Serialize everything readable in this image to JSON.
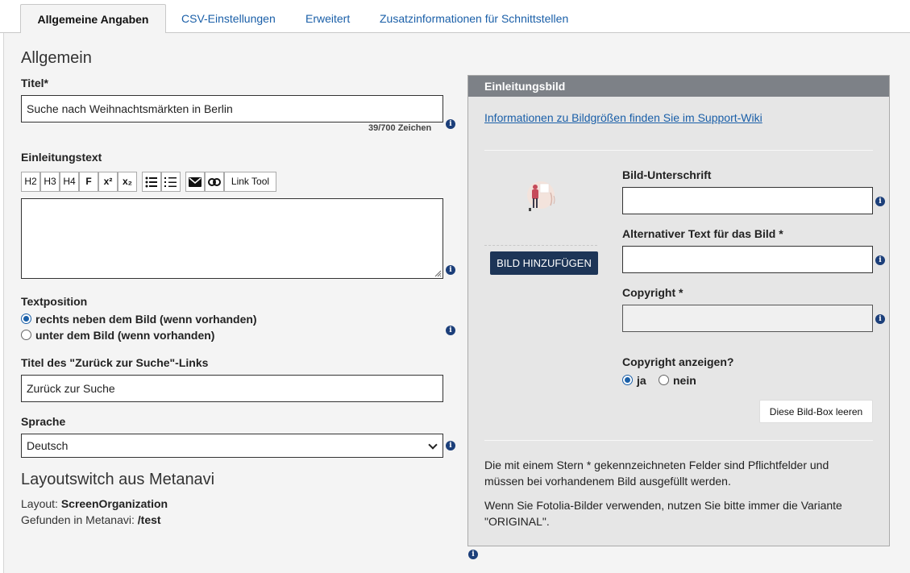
{
  "tabs": [
    {
      "label": "Allgemeine Angaben",
      "active": true
    },
    {
      "label": "CSV-Einstellungen",
      "active": false
    },
    {
      "label": "Erweitert",
      "active": false
    },
    {
      "label": "Zusatzinformationen für Schnittstellen",
      "active": false
    }
  ],
  "general": {
    "heading": "Allgemein",
    "title_label": "Titel*",
    "title_value": "Suche nach Weihnachtsmärkten in Berlin",
    "title_counter": "39/700 Zeichen",
    "intro_label": "Einleitungstext",
    "toolbar": {
      "h2": "H2",
      "h3": "H3",
      "h4": "H4",
      "bold": "F",
      "sup": "x²",
      "sub": "x₂",
      "link_tool": "Link Tool"
    },
    "textposition_label": "Textposition",
    "textposition_options": [
      {
        "label": "rechts neben dem Bild (wenn vorhanden)",
        "selected": true
      },
      {
        "label": "unter dem Bild (wenn vorhanden)",
        "selected": false
      }
    ],
    "back_link_label": "Titel des \"Zurück zur Suche\"-Links",
    "back_link_value": "Zurück zur Suche",
    "language_label": "Sprache",
    "language_value": "Deutsch"
  },
  "layoutswitch": {
    "heading": "Layoutswitch aus Metanavi",
    "layout_label": "Layout:",
    "layout_value": "ScreenOrganization",
    "found_label": "Gefunden in Metanavi:",
    "found_value": "/test"
  },
  "image_panel": {
    "heading": "Einleitungsbild",
    "support_link": "Informationen zu Bildgrößen finden Sie im Support-Wiki",
    "add_button": "BILD HINZUFÜGEN",
    "caption_label": "Bild-Unterschrift",
    "caption_value": "",
    "alt_label": "Alternativer Text für das Bild *",
    "alt_value": "",
    "copyright_label": "Copyright *",
    "copyright_value": "",
    "show_copyright_label": "Copyright anzeigen?",
    "show_copyright_options": [
      {
        "label": "ja",
        "selected": true
      },
      {
        "label": "nein",
        "selected": false
      }
    ],
    "clear_button": "Diese Bild-Box leeren",
    "note_1": "Die mit einem Stern * gekennzeichneten Felder sind Pflichtfelder und müssen bei vorhandenem Bild ausgefüllt werden.",
    "note_2": "Wenn Sie Fotolia-Bilder verwenden, nutzen Sie bitte immer die Variante \"ORIGINAL\"."
  },
  "icons": {
    "info": "info-icon",
    "envelope": "envelope-icon",
    "link": "link-icon",
    "bullet_list": "bullet-list-icon",
    "numbered_list": "numbered-list-icon",
    "placeholder_image": "image-placeholder-icon"
  },
  "colors": {
    "link": "#1a5fa8",
    "panel_header": "#7d8187",
    "primary_button": "#1d3557",
    "info_icon": "#1c3f7a"
  }
}
